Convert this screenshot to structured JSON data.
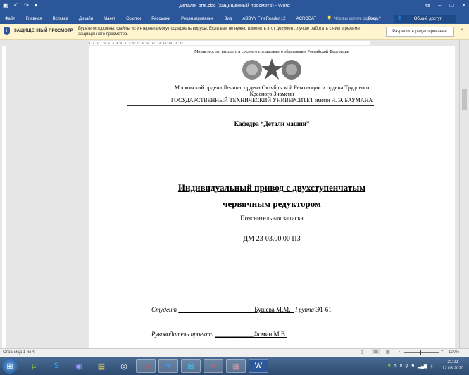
{
  "window": {
    "title": "Детали_prts.doc (защищенный просмотр) - Word",
    "qat": [
      "save-icon",
      "undo-icon",
      "redo-icon",
      "customize-icon"
    ],
    "controls": [
      "ribbon-options-icon",
      "minimize-icon",
      "maximize-icon",
      "close-icon"
    ]
  },
  "ribbon": {
    "tabs": [
      "Файл",
      "Главная",
      "Вставка",
      "Дизайн",
      "Макет",
      "Ссылки",
      "Рассылки",
      "Рецензирование",
      "Вид",
      "ABBYY FineReader 12",
      "ACROBAT"
    ],
    "tell_me": "Что вы хотите сделать?",
    "signin": "Вход",
    "share": "Общий доступ"
  },
  "message_bar": {
    "title": "ЗАЩИЩЕННЫЙ ПРОСМОТР",
    "text": "Будьте осторожны: файлы из Интернета могут содержать вирусы. Если вам не нужно изменять этот документ, лучше работать с ним в режиме защищенного просмотра.",
    "button": "Разрешить редактирование",
    "close": "×"
  },
  "ruler": {
    "ticks": "3 · 2 · 1 · | · 1 · 2 · 3 · 4 · 5 · 6 · 7 · 8 · 9 · 10 · 11 · 12 · 13 · 14 · 15 · 16 · 17"
  },
  "document": {
    "ministry": "Министерство высшего и среднего специального образования Российской Федерации",
    "univ_line1": "Московский ордена Ленина, ордена Октябрьской Революции и ордена Трудового",
    "univ_line2": "Красного Знамени",
    "univ_line3": "ГОСУДАРСТВЕННЫЙ  ТЕХНИЧЕСКИЙ УНИВЕРСИТЕТ имени Н. Э. БАУМАНА",
    "department": "Кафедра “Детали машин”",
    "title_line1": "Индивидуальный привод с двухступенчатым",
    "title_line2": "червячным редуктором",
    "subtitle": "Пояснительная записка",
    "code": "ДМ 23-03.00.00 ПЗ",
    "student_label": "Студент",
    "student_blank": "________________________",
    "student_name": "Бушева М.М.  ",
    "group_label": "Группа",
    "group": "Э1-61",
    "supervisor_label": "Руководитель проекта",
    "supervisor_blank": "____________",
    "supervisor_name": "Фомин М.В."
  },
  "status": {
    "page": "Страница 1 из 4",
    "zoom": "100%"
  },
  "taskbar": {
    "clock_time": "21:22",
    "clock_date": "12.03.2020"
  }
}
